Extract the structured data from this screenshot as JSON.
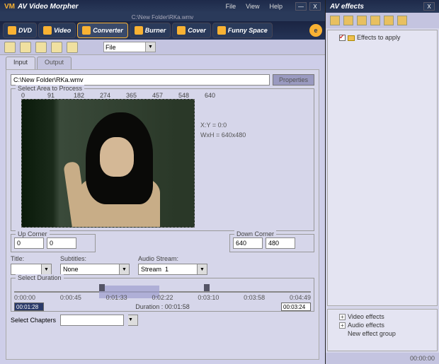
{
  "app": {
    "logo_prefix": "VM",
    "title": "AV Video Morpher"
  },
  "menubar": {
    "file": "File",
    "view": "View",
    "help": "Help"
  },
  "pathbar": "C:\\New Folder\\RKa.wmv",
  "navtabs": {
    "dvd": "DVD",
    "video": "Video",
    "converter": "Converter",
    "burner": "Burner",
    "cover": "Cover",
    "funny": "Funny Space"
  },
  "toolbar": {
    "file_label": "File"
  },
  "iotabs": {
    "input": "Input",
    "output": "Output"
  },
  "filepath": "C:\\New Folder\\RKa.wmv",
  "properties_btn": "Properties",
  "select_area": "Select Area to Process",
  "ruler": [
    "0",
    "91",
    "182",
    "274",
    "365",
    "457",
    "548",
    "640"
  ],
  "coords": {
    "xy_label": "X:Y = ",
    "xy_val": "0:0",
    "wh_label": "WxH = ",
    "wh_val": "640x480"
  },
  "up_corner": {
    "label": "Up Corner",
    "x": "0",
    "y": "0"
  },
  "down_corner": {
    "label": "Down Corner",
    "x": "640",
    "y": "480"
  },
  "streams": {
    "title_label": "Title:",
    "title_val": "",
    "sub_label": "Subtitles:",
    "sub_val": "None",
    "audio_label": "Audio Stream:",
    "audio_val": "Stream  1"
  },
  "duration": {
    "legend": "Select Duration",
    "ticks": [
      "0:00:00",
      "0:00:45",
      "0:01:33",
      "0:02:22",
      "0:03:10",
      "0:03:58",
      "0:04:49"
    ],
    "in": "00:01:28",
    "dur_label": "Duration : ",
    "dur_val": "00:01:58",
    "out": "00:03:24"
  },
  "chapters": "Select Chapters",
  "side": {
    "title": "AV effects",
    "apply": "Effects to apply",
    "video": "Video effects",
    "audio": "Audio effects",
    "newgroup": "New effect group",
    "time": "00:00:00"
  }
}
